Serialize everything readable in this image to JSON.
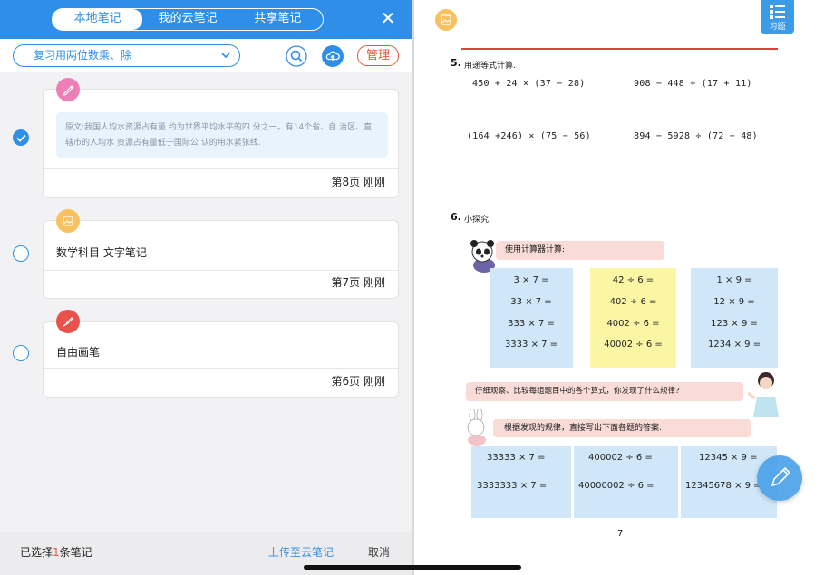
{
  "header": {
    "tabs": [
      {
        "label": "本地笔记",
        "active": true
      },
      {
        "label": "我的云笔记",
        "active": false
      },
      {
        "label": "共享笔记",
        "active": false
      }
    ],
    "close_symbol": "✕"
  },
  "filter": {
    "selected": "复习用两位数乘、除",
    "manage_label": "管理"
  },
  "notes": [
    {
      "type": "highlight",
      "icon": "pen-icon",
      "icon_color": "#ee7fb6",
      "checked": true,
      "quote": "原文:我国人均水资源占有量 约为世界平均水平的四 分之一。有14个省、自 治区、直辖市的人均水 资源占有量低于国际公 认的用水紧张线.",
      "footer": "第8页 刚刚"
    },
    {
      "type": "text",
      "icon": "image-icon",
      "icon_color": "#f6c15e",
      "checked": false,
      "text": "数学科目 文字笔记",
      "footer": "第7页 刚刚"
    },
    {
      "type": "drawing",
      "icon": "brush-icon",
      "icon_color": "#e8524a",
      "checked": false,
      "text": "自由画笔",
      "footer": "第6页 刚刚"
    }
  ],
  "bottom": {
    "selected_prefix": "已选择",
    "selected_count": "1",
    "selected_suffix": "条笔记",
    "upload_label": "上传至云笔记",
    "cancel_label": "取消"
  },
  "book": {
    "exercise_label": "习题",
    "q5": {
      "num": "5.",
      "title": "用递等式计算.",
      "equations": [
        "450 + 24  × (37 − 28)",
        "908 − 448 ÷ (17 + 11)",
        "(164 +246) × (75 − 56)",
        "894 − 5928 ÷ (72 − 48)"
      ]
    },
    "q6": {
      "num": "6.",
      "title": "小探究.",
      "bubble1": "使用计算器计算:",
      "col1": [
        "3 × 7 =",
        "33 × 7 =",
        "333 × 7 =",
        "3333 × 7 ="
      ],
      "col2": [
        "42 ÷ 6 =",
        "402 ÷ 6 =",
        "4002 ÷ 6 =",
        "40002 ÷ 6 ="
      ],
      "col3": [
        "1 × 9 =",
        "12 × 9 =",
        "123 × 9 =",
        "1234 × 9 ="
      ],
      "bubble2": "仔细观察、比较每组题目中的各个算式，你发现了什么规律?",
      "bubble3": "根据发现的规律，直接写出下面各题的答案.",
      "ans1": [
        "33333 × 7 =",
        "3333333 × 7 ="
      ],
      "ans2": [
        "400002 ÷ 6 =",
        "40000002 ÷ 6 ="
      ],
      "ans3": [
        "12345 × 9 =",
        "12345678 × 9 ="
      ]
    },
    "page_number": "7"
  }
}
